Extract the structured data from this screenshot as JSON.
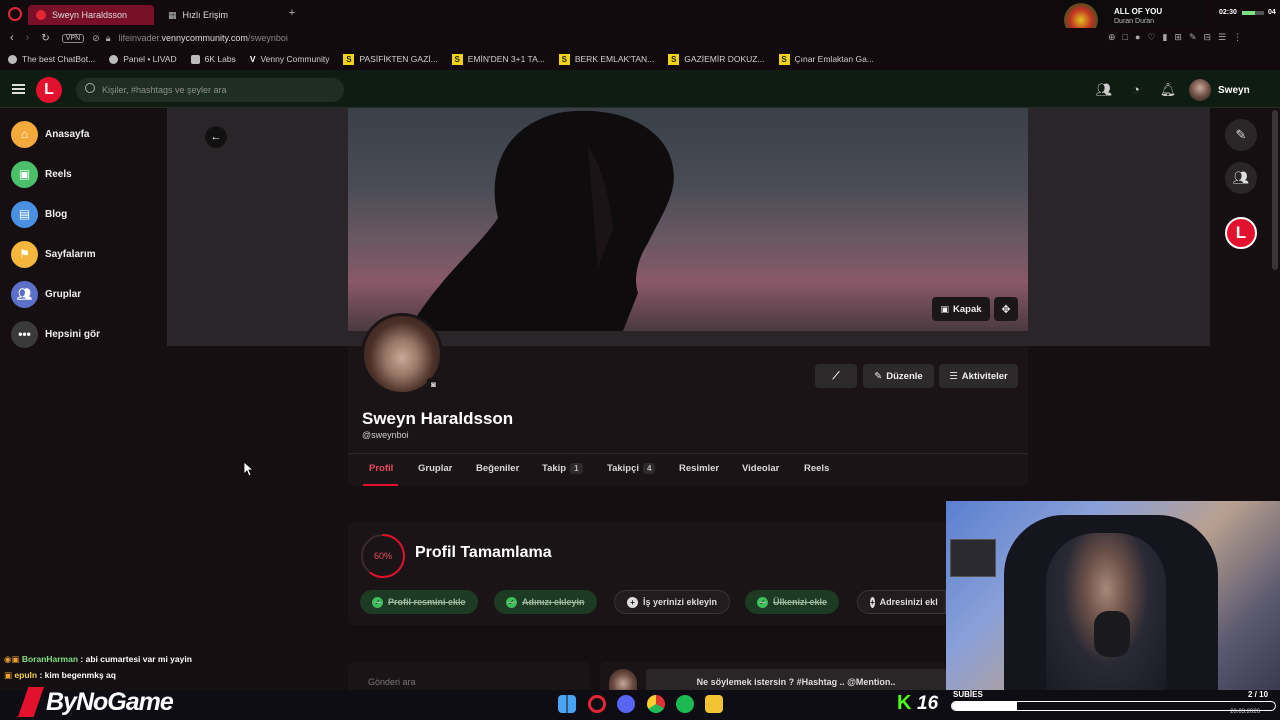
{
  "browser": {
    "tabs": [
      {
        "label": "Sweyn Haraldsson"
      },
      {
        "label": "Hızlı Erişim"
      }
    ],
    "new_tab": "+",
    "vpn": "VPN",
    "url_prefix": "lifeinvader.",
    "url_domain": "vennycommunity.com",
    "url_path": "/sweynboi",
    "bookmarks": [
      "The best ChatBot...",
      "Panel • LIVAD",
      "6K Labs",
      "Venny Community",
      "PASİFİKTEN GAZİ...",
      "EMİN'DEN 3+1 TA...",
      "BERK EMLAK'TAN...",
      "GAZİEMİR DOKUZ...",
      "Çınar Emlaktan Ga..."
    ]
  },
  "music": {
    "title": "ALL OF YOU",
    "artist": "Duran Duran"
  },
  "clock": {
    "time": "02:30",
    "date": "20.03.2026",
    "extra": "04"
  },
  "header": {
    "logo": "L",
    "search_placeholder": "Kişiler, #hashtags ve şeyler ara",
    "user_name": "Sweyn"
  },
  "sidebar": {
    "items": [
      {
        "label": "Anasayfa",
        "color": "#f4a93b"
      },
      {
        "label": "Reels",
        "color": "#4cbf6a"
      },
      {
        "label": "Blog",
        "color": "#4a90e2"
      },
      {
        "label": "Sayfalarım",
        "color": "#f4b63b"
      },
      {
        "label": "Gruplar",
        "color": "#5c6fc9"
      },
      {
        "label": "Hepsini gör",
        "color": "#3a3a3a"
      }
    ]
  },
  "profile": {
    "cover_button": "Kapak",
    "name": "Sweyn Haraldsson",
    "handle": "@sweynboi",
    "edit_button": "Düzenle",
    "activities_button": "Aktiviteler",
    "tabs": [
      {
        "label": "Profil"
      },
      {
        "label": "Gruplar"
      },
      {
        "label": "Beğeniler"
      },
      {
        "label": "Takip",
        "count": "1"
      },
      {
        "label": "Takipçi",
        "count": "4"
      },
      {
        "label": "Resimler"
      },
      {
        "label": "Videolar"
      },
      {
        "label": "Reels"
      }
    ]
  },
  "completion": {
    "title": "Profil Tamamlama",
    "percent_label": "60%",
    "percent": 60,
    "chips": [
      {
        "label": "Profil resmini ekle",
        "done": true
      },
      {
        "label": "Adınızı ekleyin",
        "done": true
      },
      {
        "label": "İş yerinizi ekleyin",
        "done": false
      },
      {
        "label": "Ülkenizi ekle",
        "done": true
      },
      {
        "label": "Adresinizi ekl",
        "done": false
      }
    ]
  },
  "composer": {
    "search_placeholder": "Gönderi ara",
    "prompt": "Ne söylemek istersin ? #Hashtag .. @Mention.."
  },
  "chat": [
    {
      "user": "BoranHarman",
      "message": ": abi cumartesi var mi yayin",
      "color": "#7ee07e"
    },
    {
      "user": "epuln",
      "message": ": kim begenmkş aq",
      "color": "#f0d050"
    }
  ],
  "stream": {
    "brand": "ByNoGame",
    "k_number": "16",
    "subs_label": "SUBİES",
    "subs_count": "2 / 10"
  },
  "colors": {
    "accent": "#e3112d",
    "header_bg": "#0f1c12",
    "done_green": "#3fbf5a"
  }
}
